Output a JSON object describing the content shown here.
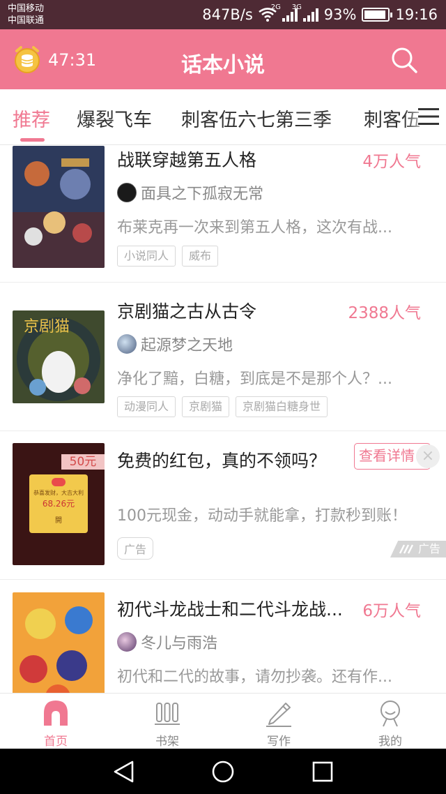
{
  "status_bar": {
    "carrier_1": "中国移动",
    "carrier_2": "中国联通",
    "net_speed": "847B/s",
    "net_type_1": "2G",
    "net_type_2": "3G",
    "battery": "93%",
    "battery_level": 0.93,
    "time": "19:16"
  },
  "header": {
    "timer": "47:31",
    "title": "话本小说",
    "icons": {
      "left": "coin-timer-icon",
      "right": "search-icon"
    }
  },
  "tabs": {
    "items": [
      "推荐",
      "爆裂飞车",
      "刺客伍六七第三季",
      "刺客伍"
    ],
    "active_index": 0,
    "menu_icon": "menu-icon"
  },
  "feed": [
    {
      "title": "战联穿越第五人格",
      "popularity": "4万人气",
      "author": "面具之下孤寂无常",
      "description": "布莱克再一次来到第五人格，这次有战...",
      "tags": [
        "小说同人",
        "威布"
      ]
    },
    {
      "title": "京剧猫之古从古令",
      "popularity": "2388人气",
      "author": "起源梦之天地",
      "description": "净化了黯，白糖，到底是不是那个人？...",
      "tags": [
        "动漫同人",
        "京剧猫",
        "京剧猫白糖身世"
      ]
    },
    {
      "ad": true,
      "title": "免费的红包，真的不领吗？",
      "cta": "查看详情",
      "description": "100元现金，动动手就能拿，打款秒到账！",
      "ad_label": "广告",
      "ad_badge": "广告",
      "cover_text": {
        "amount_top": "50元",
        "envelope_line": "恭喜发财，大吉大利",
        "envelope_amount": "68.26元",
        "open": "開"
      }
    },
    {
      "title": "初代斗龙战士和二代斗龙战...",
      "popularity": "6万人气",
      "author": "冬儿与雨浩",
      "description": "初代和二代的故事，请勿抄袭。还有作..."
    }
  ],
  "bottom_nav": [
    {
      "label": "首页",
      "icon": "home-icon",
      "active": true
    },
    {
      "label": "书架",
      "icon": "bookshelf-icon",
      "active": false
    },
    {
      "label": "写作",
      "icon": "pencil-icon",
      "active": false
    },
    {
      "label": "我的",
      "icon": "profile-icon",
      "active": false
    }
  ],
  "colors": {
    "accent": "#f07891",
    "status_bar": "#4e2a34",
    "text_primary": "#222222",
    "text_secondary": "#999999"
  }
}
